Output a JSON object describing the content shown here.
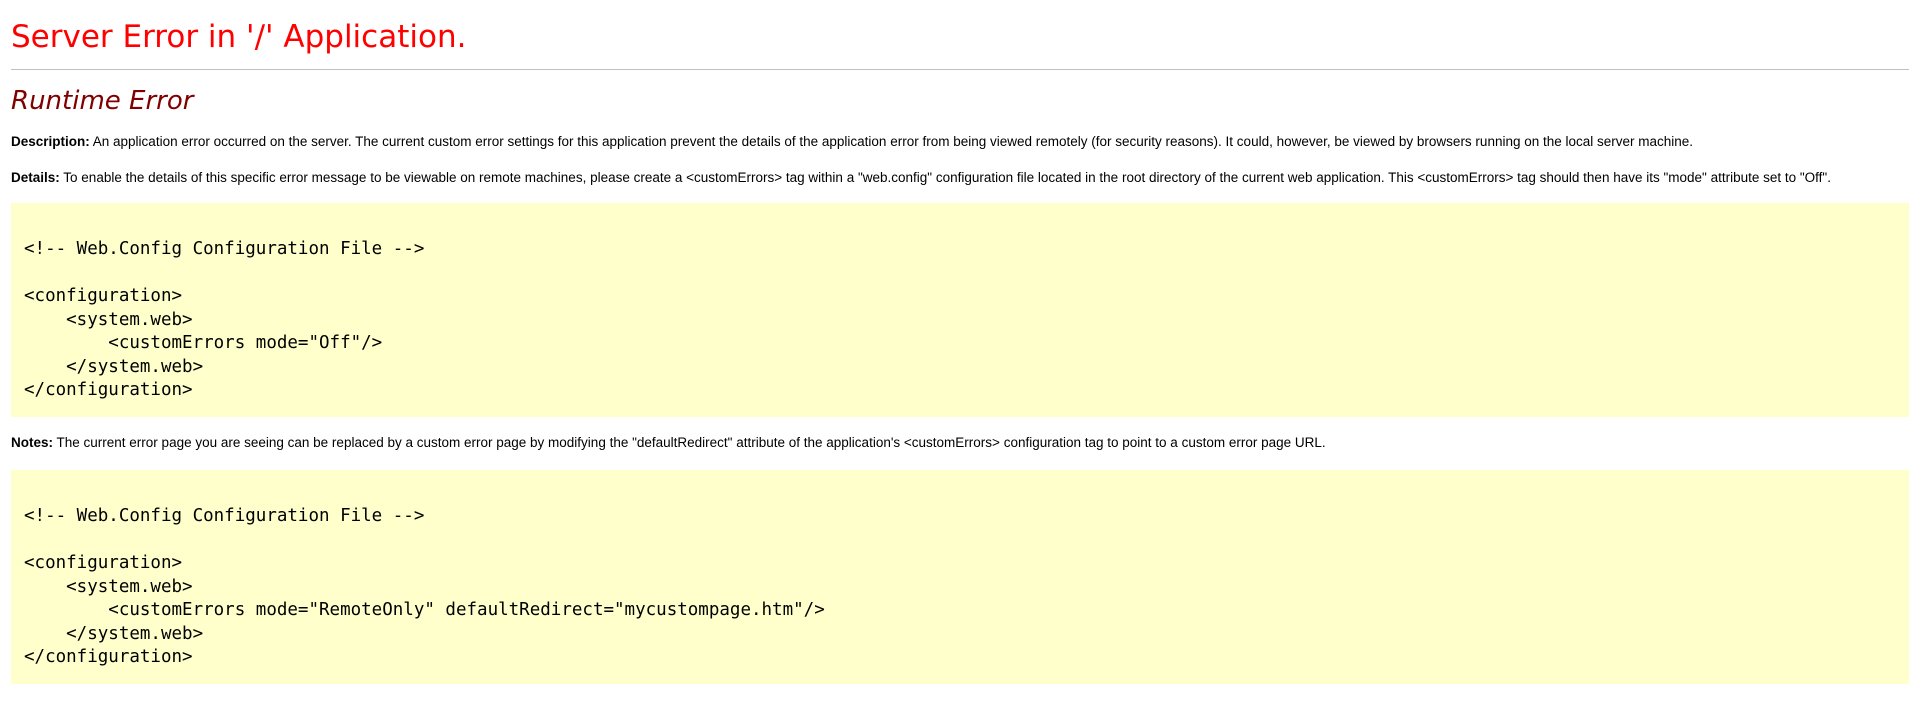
{
  "header": {
    "title": "Server Error in '/' Application.",
    "subtitle": "Runtime Error"
  },
  "description": {
    "label": "Description:",
    "text": " An application error occurred on the server. The current custom error settings for this application prevent the details of the application error from being viewed remotely (for security reasons). It could, however, be viewed by browsers running on the local server machine."
  },
  "details": {
    "label": "Details:",
    "text": " To enable the details of this specific error message to be viewable on remote machines, please create a <customErrors> tag within a \"web.config\" configuration file located in the root directory of the current web application. This <customErrors> tag should then have its \"mode\" attribute set to \"Off\"."
  },
  "code_block_1": {
    "text": "<!-- Web.Config Configuration File -->\n\n<configuration>\n    <system.web>\n        <customErrors mode=\"Off\"/>\n    </system.web>\n</configuration>"
  },
  "notes": {
    "label": "Notes:",
    "text": " The current error page you are seeing can be replaced by a custom error page by modifying the \"defaultRedirect\" attribute of the application's <customErrors> configuration tag to point to a custom error page URL."
  },
  "code_block_2": {
    "text": "<!-- Web.Config Configuration File -->\n\n<configuration>\n    <system.web>\n        <customErrors mode=\"RemoteOnly\" defaultRedirect=\"mycustompage.htm\"/>\n    </system.web>\n</configuration>"
  },
  "colors": {
    "title": "#ff0000",
    "subtitle": "#800000",
    "code_background": "#ffffcc",
    "rule": "#c0c0c0"
  }
}
